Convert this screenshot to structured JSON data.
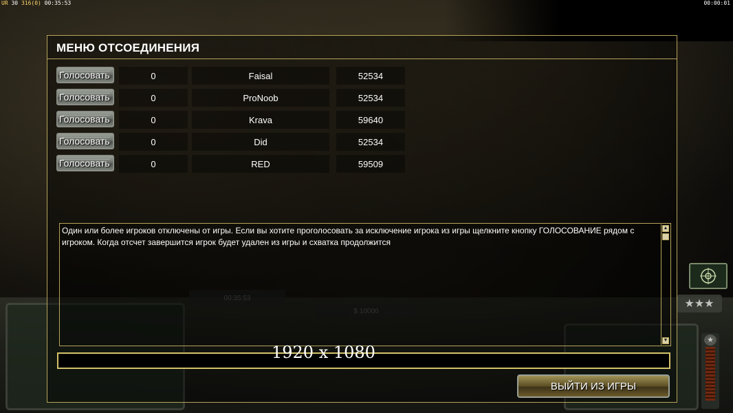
{
  "hud": {
    "top_left_a": "UR",
    "top_left_b": "30",
    "top_left_c": "316",
    "top_left_d": "(0)",
    "top_left_time": "00:35:53",
    "top_right_time": "00:00:01"
  },
  "background_ui": {
    "timer": "00:35:53",
    "money": "$ 10000"
  },
  "dialog": {
    "title": "МЕНЮ ОТСОЕДИНЕНИЯ",
    "vote_label": "Голосовать",
    "players": [
      {
        "votes": "0",
        "name": "Faisal",
        "ping": "52534"
      },
      {
        "votes": "0",
        "name": "ProNoob",
        "ping": "52534"
      },
      {
        "votes": "0",
        "name": "Krava",
        "ping": "59640"
      },
      {
        "votes": "0",
        "name": "Did",
        "ping": "52534"
      },
      {
        "votes": "0",
        "name": "RED",
        "ping": "59509"
      }
    ],
    "message": "Один или более игроков отключены от игры. Если вы хотите проголосовать за исключение игрока из игры щелкните кнопку  ГОЛОСОВАНИЕ рядом с игроком. Когда отсчет завершится игрок будет удален из игры и схватка продолжится",
    "chat_value": "",
    "quit_label": "ВЫЙТИ ИЗ ИГРЫ"
  },
  "overlay": {
    "resolution": "1920 x 1080"
  },
  "colors": {
    "border_gold": "#b7a45a",
    "input_border": "#d4c26a"
  }
}
